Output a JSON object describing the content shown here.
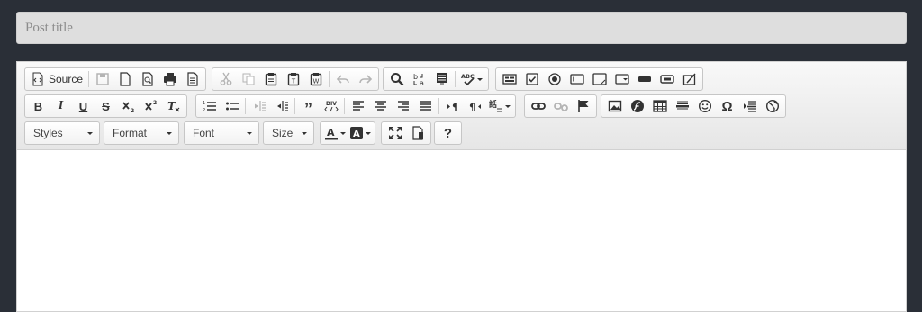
{
  "post_title": {
    "placeholder": "Post title",
    "value": ""
  },
  "toolbar": {
    "source_label": "Source",
    "styles_label": "Styles",
    "format_label": "Format",
    "font_label": "Font",
    "size_label": "Size",
    "help_label": "?"
  },
  "colors": {
    "page_bg": "#2a2f37",
    "toolbar_bg": "#efefef",
    "title_bg": "#dedede"
  }
}
